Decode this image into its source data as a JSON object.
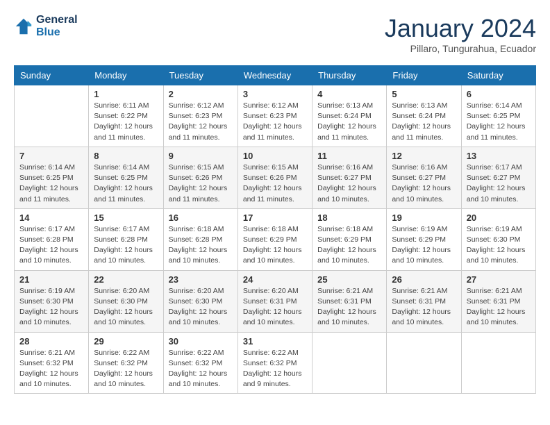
{
  "logo": {
    "line1": "General",
    "line2": "Blue"
  },
  "header": {
    "month": "January 2024",
    "location": "Pillaro, Tungurahua, Ecuador"
  },
  "weekdays": [
    "Sunday",
    "Monday",
    "Tuesday",
    "Wednesday",
    "Thursday",
    "Friday",
    "Saturday"
  ],
  "weeks": [
    [
      {
        "day": "",
        "info": ""
      },
      {
        "day": "1",
        "info": "Sunrise: 6:11 AM\nSunset: 6:22 PM\nDaylight: 12 hours and 11 minutes."
      },
      {
        "day": "2",
        "info": "Sunrise: 6:12 AM\nSunset: 6:23 PM\nDaylight: 12 hours and 11 minutes."
      },
      {
        "day": "3",
        "info": "Sunrise: 6:12 AM\nSunset: 6:23 PM\nDaylight: 12 hours and 11 minutes."
      },
      {
        "day": "4",
        "info": "Sunrise: 6:13 AM\nSunset: 6:24 PM\nDaylight: 12 hours and 11 minutes."
      },
      {
        "day": "5",
        "info": "Sunrise: 6:13 AM\nSunset: 6:24 PM\nDaylight: 12 hours and 11 minutes."
      },
      {
        "day": "6",
        "info": "Sunrise: 6:14 AM\nSunset: 6:25 PM\nDaylight: 12 hours and 11 minutes."
      }
    ],
    [
      {
        "day": "7",
        "info": "Sunrise: 6:14 AM\nSunset: 6:25 PM\nDaylight: 12 hours and 11 minutes."
      },
      {
        "day": "8",
        "info": "Sunrise: 6:14 AM\nSunset: 6:25 PM\nDaylight: 12 hours and 11 minutes."
      },
      {
        "day": "9",
        "info": "Sunrise: 6:15 AM\nSunset: 6:26 PM\nDaylight: 12 hours and 11 minutes."
      },
      {
        "day": "10",
        "info": "Sunrise: 6:15 AM\nSunset: 6:26 PM\nDaylight: 12 hours and 11 minutes."
      },
      {
        "day": "11",
        "info": "Sunrise: 6:16 AM\nSunset: 6:27 PM\nDaylight: 12 hours and 10 minutes."
      },
      {
        "day": "12",
        "info": "Sunrise: 6:16 AM\nSunset: 6:27 PM\nDaylight: 12 hours and 10 minutes."
      },
      {
        "day": "13",
        "info": "Sunrise: 6:17 AM\nSunset: 6:27 PM\nDaylight: 12 hours and 10 minutes."
      }
    ],
    [
      {
        "day": "14",
        "info": "Sunrise: 6:17 AM\nSunset: 6:28 PM\nDaylight: 12 hours and 10 minutes."
      },
      {
        "day": "15",
        "info": "Sunrise: 6:17 AM\nSunset: 6:28 PM\nDaylight: 12 hours and 10 minutes."
      },
      {
        "day": "16",
        "info": "Sunrise: 6:18 AM\nSunset: 6:28 PM\nDaylight: 12 hours and 10 minutes."
      },
      {
        "day": "17",
        "info": "Sunrise: 6:18 AM\nSunset: 6:29 PM\nDaylight: 12 hours and 10 minutes."
      },
      {
        "day": "18",
        "info": "Sunrise: 6:18 AM\nSunset: 6:29 PM\nDaylight: 12 hours and 10 minutes."
      },
      {
        "day": "19",
        "info": "Sunrise: 6:19 AM\nSunset: 6:29 PM\nDaylight: 12 hours and 10 minutes."
      },
      {
        "day": "20",
        "info": "Sunrise: 6:19 AM\nSunset: 6:30 PM\nDaylight: 12 hours and 10 minutes."
      }
    ],
    [
      {
        "day": "21",
        "info": "Sunrise: 6:19 AM\nSunset: 6:30 PM\nDaylight: 12 hours and 10 minutes."
      },
      {
        "day": "22",
        "info": "Sunrise: 6:20 AM\nSunset: 6:30 PM\nDaylight: 12 hours and 10 minutes."
      },
      {
        "day": "23",
        "info": "Sunrise: 6:20 AM\nSunset: 6:30 PM\nDaylight: 12 hours and 10 minutes."
      },
      {
        "day": "24",
        "info": "Sunrise: 6:20 AM\nSunset: 6:31 PM\nDaylight: 12 hours and 10 minutes."
      },
      {
        "day": "25",
        "info": "Sunrise: 6:21 AM\nSunset: 6:31 PM\nDaylight: 12 hours and 10 minutes."
      },
      {
        "day": "26",
        "info": "Sunrise: 6:21 AM\nSunset: 6:31 PM\nDaylight: 12 hours and 10 minutes."
      },
      {
        "day": "27",
        "info": "Sunrise: 6:21 AM\nSunset: 6:31 PM\nDaylight: 12 hours and 10 minutes."
      }
    ],
    [
      {
        "day": "28",
        "info": "Sunrise: 6:21 AM\nSunset: 6:32 PM\nDaylight: 12 hours and 10 minutes."
      },
      {
        "day": "29",
        "info": "Sunrise: 6:22 AM\nSunset: 6:32 PM\nDaylight: 12 hours and 10 minutes."
      },
      {
        "day": "30",
        "info": "Sunrise: 6:22 AM\nSunset: 6:32 PM\nDaylight: 12 hours and 10 minutes."
      },
      {
        "day": "31",
        "info": "Sunrise: 6:22 AM\nSunset: 6:32 PM\nDaylight: 12 hours and 9 minutes."
      },
      {
        "day": "",
        "info": ""
      },
      {
        "day": "",
        "info": ""
      },
      {
        "day": "",
        "info": ""
      }
    ]
  ]
}
